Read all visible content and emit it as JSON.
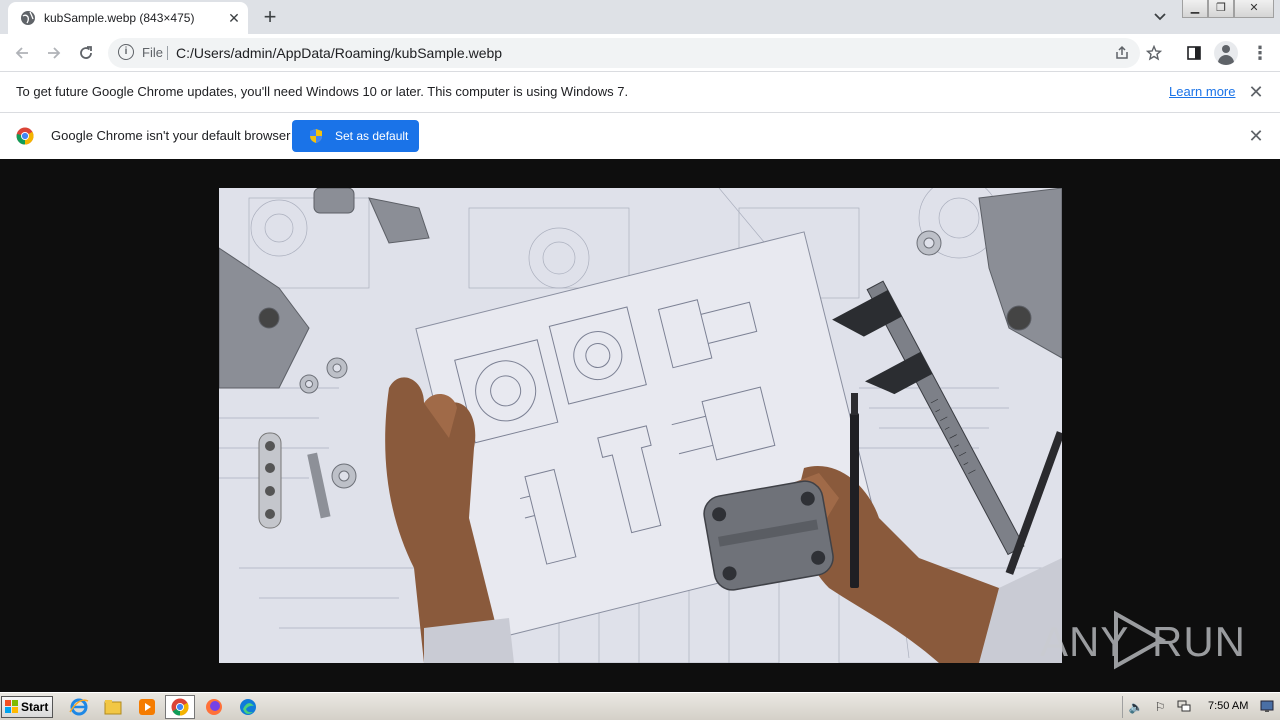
{
  "browser": {
    "tab_title": "kubSample.webp (843×475)",
    "address_scheme_label": "File",
    "address_url": "C:/Users/admin/AppData/Roaming/kubSample.webp"
  },
  "infobar_update": {
    "message": "To get future Google Chrome updates, you'll need Windows 10 or later. This computer is using Windows 7.",
    "link": "Learn more"
  },
  "infobar_default": {
    "message": "Google Chrome isn't your default browser",
    "button": "Set as default"
  },
  "image": {
    "description_icon": "engineering-blueprint-photo",
    "dimensions": "843×475"
  },
  "watermark": {
    "left": "ANY",
    "right": "RUN"
  },
  "taskbar": {
    "start_label": "Start",
    "clock": "7:50 AM"
  },
  "colors": {
    "accent": "#1a73e8",
    "viewer_bg": "#0e0e0e"
  }
}
